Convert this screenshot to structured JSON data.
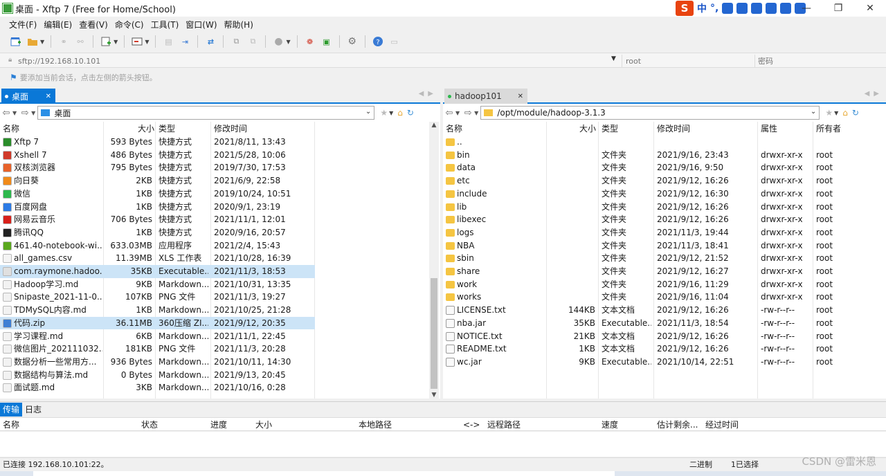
{
  "window": {
    "title": "桌面 - Xftp 7 (Free for Home/School)",
    "controls": [
      "—",
      "❐",
      "✕"
    ]
  },
  "ime": {
    "logo": "S",
    "lang": "中",
    "punct": "°,"
  },
  "menu": [
    "文件(F)",
    "编辑(E)",
    "查看(V)",
    "命令(C)",
    "工具(T)",
    "窗口(W)",
    "帮助(H)"
  ],
  "address": {
    "placeholder": "sftp://192.168.10.101",
    "user_placeholder": "root",
    "password_placeholder": "密码"
  },
  "hint": "要添加当前会话，点击左侧的箭头按钮。",
  "left_pane": {
    "tab": "桌面",
    "path": "桌面",
    "columns": [
      "名称",
      "大小",
      "类型",
      "修改时间"
    ],
    "files": [
      {
        "name": "Xftp 7",
        "size": "593 Bytes",
        "type": "快捷方式",
        "mtime": "2021/8/11, 13:43",
        "icon": "xftp-icon",
        "color": "#2a8c2a"
      },
      {
        "name": "Xshell 7",
        "size": "486 Bytes",
        "type": "快捷方式",
        "mtime": "2021/5/28, 10:06",
        "icon": "xshell-icon",
        "color": "#d03a2a"
      },
      {
        "name": "双核浏览器",
        "size": "795 Bytes",
        "type": "快捷方式",
        "mtime": "2019/7/30, 17:53",
        "icon": "browser-icon",
        "color": "#e8622a"
      },
      {
        "name": "向日葵",
        "size": "2KB",
        "type": "快捷方式",
        "mtime": "2021/6/9, 22:58",
        "icon": "sunflower-icon",
        "color": "#f08a1a"
      },
      {
        "name": "微信",
        "size": "1KB",
        "type": "快捷方式",
        "mtime": "2019/10/24, 10:51",
        "icon": "wechat-icon",
        "color": "#2db84d"
      },
      {
        "name": "百度网盘",
        "size": "1KB",
        "type": "快捷方式",
        "mtime": "2020/9/1, 23:19",
        "icon": "baidu-disk-icon",
        "color": "#2c7be5"
      },
      {
        "name": "网易云音乐",
        "size": "706 Bytes",
        "type": "快捷方式",
        "mtime": "2021/11/1, 12:01",
        "icon": "netease-music-icon",
        "color": "#d8201a"
      },
      {
        "name": "腾讯QQ",
        "size": "1KB",
        "type": "快捷方式",
        "mtime": "2020/9/16, 20:57",
        "icon": "qq-icon",
        "color": "#222222"
      },
      {
        "name": "461.40-notebook-wi...",
        "size": "633.03MB",
        "type": "应用程序",
        "mtime": "2021/2/4, 15:43",
        "icon": "nvidia-icon",
        "color": "#5aa81e"
      },
      {
        "name": "all_games.csv",
        "size": "11.39MB",
        "type": "XLS 工作表",
        "mtime": "2021/10/28, 16:39",
        "icon": "csv-file-icon",
        "color": "#f4f4f4"
      },
      {
        "name": "com.raymone.hadoo...",
        "size": "35KB",
        "type": "Executable...",
        "mtime": "2021/11/3, 18:53",
        "icon": "jar-file-icon",
        "color": "#e0e0e0",
        "selected": true
      },
      {
        "name": "Hadoop学习.md",
        "size": "9KB",
        "type": "Markdown...",
        "mtime": "2021/10/31, 13:35",
        "icon": "md-file-icon",
        "color": "#f2f2f2"
      },
      {
        "name": "Snipaste_2021-11-0...",
        "size": "107KB",
        "type": "PNG 文件",
        "mtime": "2021/11/3, 19:27",
        "icon": "png-file-icon",
        "color": "#f2f2f2"
      },
      {
        "name": "TDMySQL内容.md",
        "size": "1KB",
        "type": "Markdown...",
        "mtime": "2021/10/25, 21:28",
        "icon": "md-file-icon",
        "color": "#f2f2f2"
      },
      {
        "name": "代码.zip",
        "size": "36.11MB",
        "type": "360压缩 ZI...",
        "mtime": "2021/9/12, 20:35",
        "icon": "zip-file-icon",
        "color": "#3d7fd4",
        "selected": true
      },
      {
        "name": "学习课程.md",
        "size": "6KB",
        "type": "Markdown...",
        "mtime": "2021/11/1, 22:45",
        "icon": "md-file-icon",
        "color": "#f2f2f2"
      },
      {
        "name": "微信图片_202111032...",
        "size": "181KB",
        "type": "PNG 文件",
        "mtime": "2021/11/3, 20:28",
        "icon": "png-file-icon",
        "color": "#f2f2f2"
      },
      {
        "name": "数据分析一些常用方...",
        "size": "936 Bytes",
        "type": "Markdown...",
        "mtime": "2021/10/11, 14:30",
        "icon": "md-file-icon",
        "color": "#f2f2f2"
      },
      {
        "name": "数据结构与算法.md",
        "size": "0 Bytes",
        "type": "Markdown...",
        "mtime": "2021/9/13, 20:45",
        "icon": "md-file-icon",
        "color": "#f2f2f2"
      },
      {
        "name": "面试题.md",
        "size": "3KB",
        "type": "Markdown...",
        "mtime": "2021/10/16, 0:28",
        "icon": "md-file-icon",
        "color": "#f2f2f2"
      }
    ]
  },
  "right_pane": {
    "tab": "hadoop101",
    "path": "/opt/module/hadoop-3.1.3",
    "columns": [
      "名称",
      "大小",
      "类型",
      "修改时间",
      "属性",
      "所有者"
    ],
    "files": [
      {
        "name": "..",
        "size": "",
        "type": "",
        "mtime": "",
        "attr": "",
        "owner": "",
        "icon": "folder-icon"
      },
      {
        "name": "bin",
        "size": "",
        "type": "文件夹",
        "mtime": "2021/9/16, 23:43",
        "attr": "drwxr-xr-x",
        "owner": "root",
        "icon": "folder-icon"
      },
      {
        "name": "data",
        "size": "",
        "type": "文件夹",
        "mtime": "2021/9/16, 9:50",
        "attr": "drwxr-xr-x",
        "owner": "root",
        "icon": "folder-icon"
      },
      {
        "name": "etc",
        "size": "",
        "type": "文件夹",
        "mtime": "2021/9/12, 16:26",
        "attr": "drwxr-xr-x",
        "owner": "root",
        "icon": "folder-icon"
      },
      {
        "name": "include",
        "size": "",
        "type": "文件夹",
        "mtime": "2021/9/12, 16:30",
        "attr": "drwxr-xr-x",
        "owner": "root",
        "icon": "folder-icon"
      },
      {
        "name": "lib",
        "size": "",
        "type": "文件夹",
        "mtime": "2021/9/12, 16:26",
        "attr": "drwxr-xr-x",
        "owner": "root",
        "icon": "folder-icon"
      },
      {
        "name": "libexec",
        "size": "",
        "type": "文件夹",
        "mtime": "2021/9/12, 16:26",
        "attr": "drwxr-xr-x",
        "owner": "root",
        "icon": "folder-icon"
      },
      {
        "name": "logs",
        "size": "",
        "type": "文件夹",
        "mtime": "2021/11/3, 19:44",
        "attr": "drwxr-xr-x",
        "owner": "root",
        "icon": "folder-icon"
      },
      {
        "name": "NBA",
        "size": "",
        "type": "文件夹",
        "mtime": "2021/11/3, 18:41",
        "attr": "drwxr-xr-x",
        "owner": "root",
        "icon": "folder-icon"
      },
      {
        "name": "sbin",
        "size": "",
        "type": "文件夹",
        "mtime": "2021/9/12, 21:52",
        "attr": "drwxr-xr-x",
        "owner": "root",
        "icon": "folder-icon"
      },
      {
        "name": "share",
        "size": "",
        "type": "文件夹",
        "mtime": "2021/9/12, 16:27",
        "attr": "drwxr-xr-x",
        "owner": "root",
        "icon": "folder-icon"
      },
      {
        "name": "work",
        "size": "",
        "type": "文件夹",
        "mtime": "2021/9/16, 11:29",
        "attr": "drwxr-xr-x",
        "owner": "root",
        "icon": "folder-icon"
      },
      {
        "name": "works",
        "size": "",
        "type": "文件夹",
        "mtime": "2021/9/16, 11:04",
        "attr": "drwxr-xr-x",
        "owner": "root",
        "icon": "folder-icon"
      },
      {
        "name": "LICENSE.txt",
        "size": "144KB",
        "type": "文本文档",
        "mtime": "2021/9/12, 16:26",
        "attr": "-rw-r--r--",
        "owner": "root",
        "icon": "txt-file-icon"
      },
      {
        "name": "nba.jar",
        "size": "35KB",
        "type": "Executable...",
        "mtime": "2021/11/3, 18:54",
        "attr": "-rw-r--r--",
        "owner": "root",
        "icon": "jar-file-icon"
      },
      {
        "name": "NOTICE.txt",
        "size": "21KB",
        "type": "文本文档",
        "mtime": "2021/9/12, 16:26",
        "attr": "-rw-r--r--",
        "owner": "root",
        "icon": "txt-file-icon"
      },
      {
        "name": "README.txt",
        "size": "1KB",
        "type": "文本文档",
        "mtime": "2021/9/12, 16:26",
        "attr": "-rw-r--r--",
        "owner": "root",
        "icon": "txt-file-icon"
      },
      {
        "name": "wc.jar",
        "size": "9KB",
        "type": "Executable...",
        "mtime": "2021/10/14, 22:51",
        "attr": "-rw-r--r--",
        "owner": "root",
        "icon": "jar-file-icon"
      }
    ]
  },
  "transfer": {
    "tabs": [
      "传输",
      "日志"
    ],
    "columns": [
      "名称",
      "状态",
      "进度",
      "大小",
      "本地路径",
      "<->",
      "远程路径",
      "速度",
      "估计剩余...",
      "经过时间"
    ]
  },
  "status": {
    "connected": "已连接 192.168.10.101:22。",
    "mode": "二进制",
    "selected": "1已选择"
  },
  "watermark": "CSDN @雷米恩",
  "colors": {
    "accent": "#0a78d7",
    "selected_row": "#cce4f7",
    "folder": "#f5c542"
  }
}
